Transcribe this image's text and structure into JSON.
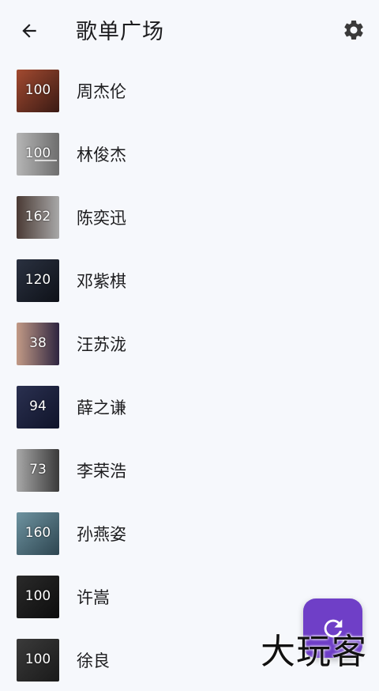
{
  "appbar": {
    "title": "歌单广场",
    "back_icon": "arrow-left-icon",
    "settings_icon": "gear-icon"
  },
  "playlists": [
    {
      "name": "周杰伦",
      "count": "100",
      "thumb_color": "#8b3b2a"
    },
    {
      "name": "林俊杰",
      "count": "100",
      "thumb_color": "#9a9a9a"
    },
    {
      "name": "陈奕迅",
      "count": "162",
      "thumb_color": "#7d7d7d"
    },
    {
      "name": "邓紫棋",
      "count": "120",
      "thumb_color": "#1d2430"
    },
    {
      "name": "汪苏泷",
      "count": "38",
      "thumb_color": "#3a2f4a"
    },
    {
      "name": "薛之谦",
      "count": "94",
      "thumb_color": "#1a1f36"
    },
    {
      "name": "李荣浩",
      "count": "73",
      "thumb_color": "#8c8c8c"
    },
    {
      "name": "孙燕姿",
      "count": "160",
      "thumb_color": "#4f6f7a"
    },
    {
      "name": "许嵩",
      "count": "100",
      "thumb_color": "#1b1b1b"
    },
    {
      "name": "徐良",
      "count": "100",
      "thumb_color": "#2b2b2b"
    }
  ],
  "fab": {
    "icon": "refresh-icon",
    "color": "#6f3fc7"
  },
  "watermark": {
    "text": "大玩客"
  }
}
